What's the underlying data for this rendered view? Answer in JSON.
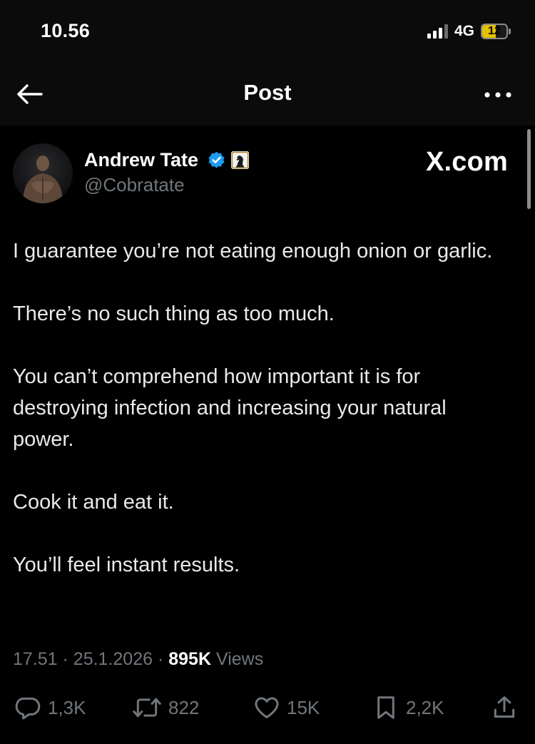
{
  "status_bar": {
    "time": "10.56",
    "network": "4G",
    "battery": "12",
    "battery_level": 0.12,
    "signal_bars_active": 3,
    "signal_bars_total": 4
  },
  "nav": {
    "title": "Post",
    "back_icon": "arrow-left-icon",
    "more_icon": "more-horizontal-icon"
  },
  "author": {
    "name": "Andrew Tate",
    "handle": "@Cobratate",
    "verified_badge_icon": "verified-badge-icon",
    "affiliate_badge_icon": "chess-knight-badge-icon"
  },
  "watermark": "X.com",
  "post": {
    "paragraphs": [
      "I guarantee you’re not eating enough onion or garlic.",
      "There’s no such thing as too much.",
      "You can’t comprehend how important it is for destroying infection and increasing your natural power.",
      "Cook it and eat it.",
      "You’ll feel instant results."
    ],
    "time": "17.51",
    "separator": "·",
    "date": "25.1.2026",
    "views_count": "895K",
    "views_label": "Views"
  },
  "actions": {
    "replies": "1,3K",
    "reposts": "822",
    "likes": "15K",
    "bookmarks": "2,2K"
  },
  "colors": {
    "background": "#000000",
    "header": "#0b0b0b",
    "text": "#e7e9ea",
    "muted": "#71767b",
    "verified": "#1d9bf0",
    "battery": "#e3c000"
  }
}
